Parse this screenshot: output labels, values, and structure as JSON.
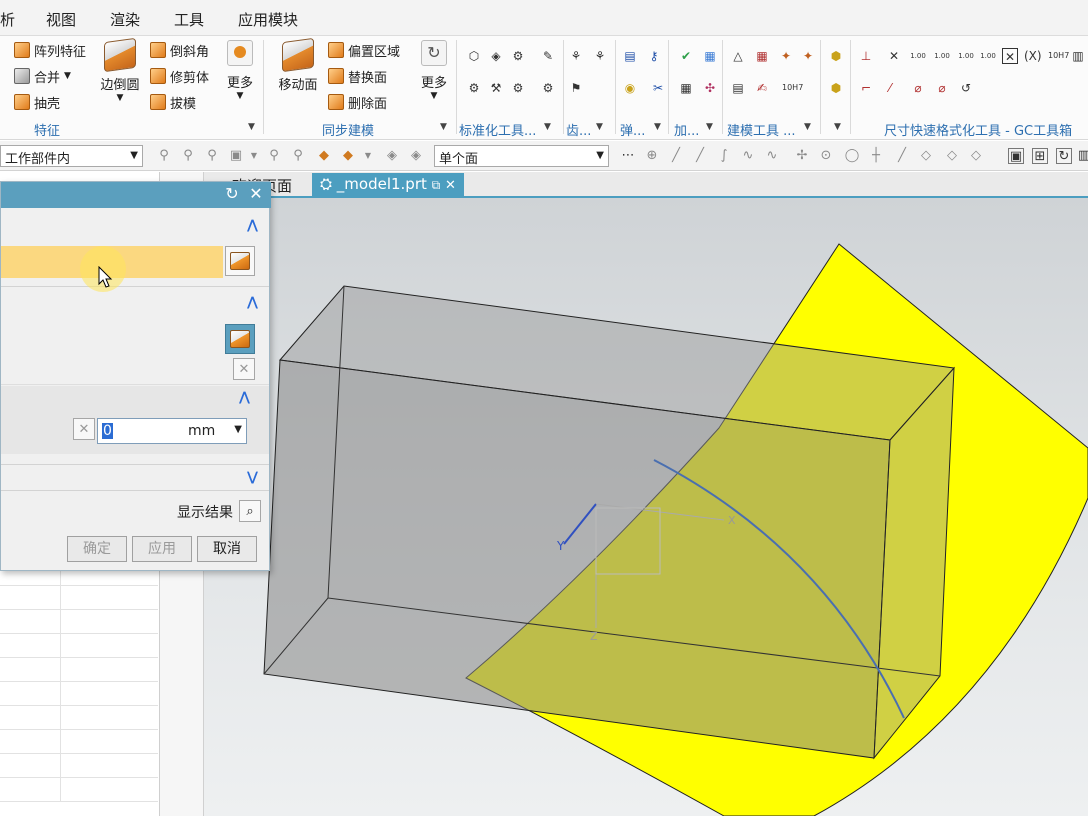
{
  "menu": {
    "items": [
      "析",
      "视图",
      "渲染",
      "工具",
      "应用模块"
    ]
  },
  "ribbon": {
    "feature_group": {
      "label": "特征",
      "pattern_feature": "阵列特征",
      "unite": "合并",
      "shell": "抽壳",
      "edge_blend": "边倒圆",
      "chamfer": "倒斜角",
      "trim_body": "修剪体",
      "draft": "拔模",
      "more": "更多"
    },
    "sync_group": {
      "label": "同步建模",
      "move_face": "移动面",
      "offset_region": "偏置区域",
      "replace_face": "替换面",
      "delete_face": "删除面",
      "more": "更多"
    },
    "tool_groups": [
      "标准化工具...",
      "齿...",
      "弹...",
      "加...",
      "建模工具 ...",
      "尺寸快速格式化工具 - GC工具箱"
    ]
  },
  "selection_bar": {
    "scope_filter": "工作部件内",
    "face_rule": "单个面"
  },
  "tabs": {
    "home_partial": "欢迎页面",
    "model_file": "_model1.prt"
  },
  "dialog": {
    "distance_value": "0",
    "distance_unit": "mm",
    "show_result": "显示结果",
    "ok": "确定",
    "apply": "应用",
    "cancel": "取消"
  },
  "colors": {
    "dialog_title": "#5b9fbe",
    "selection_highlight": "#fbd880",
    "face_yellow": "#ffff00",
    "accent_blue": "#2d6fb0"
  },
  "icons": [
    "pattern-feature-icon",
    "unite-icon",
    "shell-icon",
    "edge-blend-icon",
    "chamfer-icon",
    "trim-body-icon",
    "draft-icon",
    "move-face-icon",
    "offset-region-icon",
    "replace-face-icon",
    "delete-face-icon",
    "refresh-icon",
    "close-icon",
    "cube-icon",
    "cursor-icon"
  ]
}
